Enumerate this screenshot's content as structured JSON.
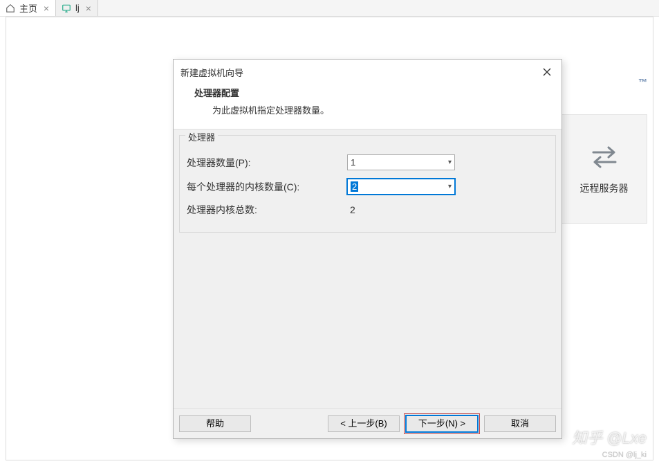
{
  "tabs": [
    {
      "label": "主页",
      "icon": "home-icon",
      "active": true
    },
    {
      "label": "lj",
      "icon": "vm-icon",
      "active": false
    }
  ],
  "background": {
    "brand_suffix": "™",
    "card": {
      "label": "远程服务器"
    }
  },
  "dialog": {
    "window_title": "新建虚拟机向导",
    "header_title": "处理器配置",
    "header_desc": "为此虚拟机指定处理器数量。",
    "group_title": "处理器",
    "rows": {
      "processors_label": "处理器数量(P):",
      "processors_value": "1",
      "cores_label": "每个处理器的内核数量(C):",
      "cores_value": "2",
      "total_label": "处理器内核总数:",
      "total_value": "2"
    },
    "buttons": {
      "help": "帮助",
      "back": "< 上一步(B)",
      "next": "下一步(N) >",
      "cancel": "取消"
    }
  },
  "watermarks": {
    "zhihu": "知乎 @Lxe",
    "csdn": "CSDN @lj_ki"
  }
}
